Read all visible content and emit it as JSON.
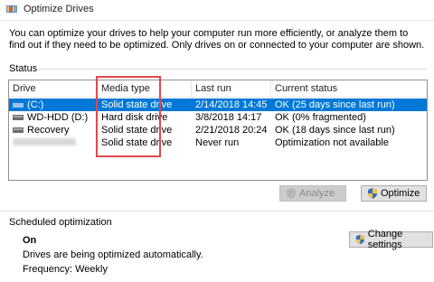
{
  "window": {
    "title": "Optimize Drives",
    "icon": "defrag-icon"
  },
  "intro_text": "You can optimize your drives to help your computer run more efficiently, or analyze them to find out if they need to be optimized. Only drives on or connected to your computer are shown.",
  "status": {
    "label": "Status",
    "columns": [
      "Drive",
      "Media type",
      "Last run",
      "Current status"
    ],
    "rows": [
      {
        "drive": "(C:)",
        "media_type": "Solid state drive",
        "last_run": "2/14/2018 14:45",
        "current_status": "OK (25 days since last run)",
        "selected": true,
        "icon": "windows-drive-icon"
      },
      {
        "drive": "WD-HDD (D:)",
        "media_type": "Hard disk drive",
        "last_run": "3/8/2018 14:17",
        "current_status": "OK (0% fragmented)",
        "selected": false,
        "icon": "hard-drive-icon"
      },
      {
        "drive": "Recovery",
        "media_type": "Solid state drive",
        "last_run": "2/21/2018 20:24",
        "current_status": "OK (18 days since last run)",
        "selected": false,
        "icon": "hard-drive-icon"
      },
      {
        "drive": "",
        "media_type": "Solid state drive",
        "last_run": "Never run",
        "current_status": "Optimization not available",
        "selected": false,
        "icon": "blurred-drive"
      }
    ]
  },
  "buttons": {
    "analyze": "Analyze",
    "optimize": "Optimize",
    "change_settings": "Change settings"
  },
  "scheduled": {
    "label": "Scheduled optimization",
    "state": "On",
    "description": "Drives are being optimized automatically.",
    "frequency": "Frequency: Weekly"
  },
  "colors": {
    "selection": "#0078d7",
    "highlight_box": "#e0484d"
  }
}
